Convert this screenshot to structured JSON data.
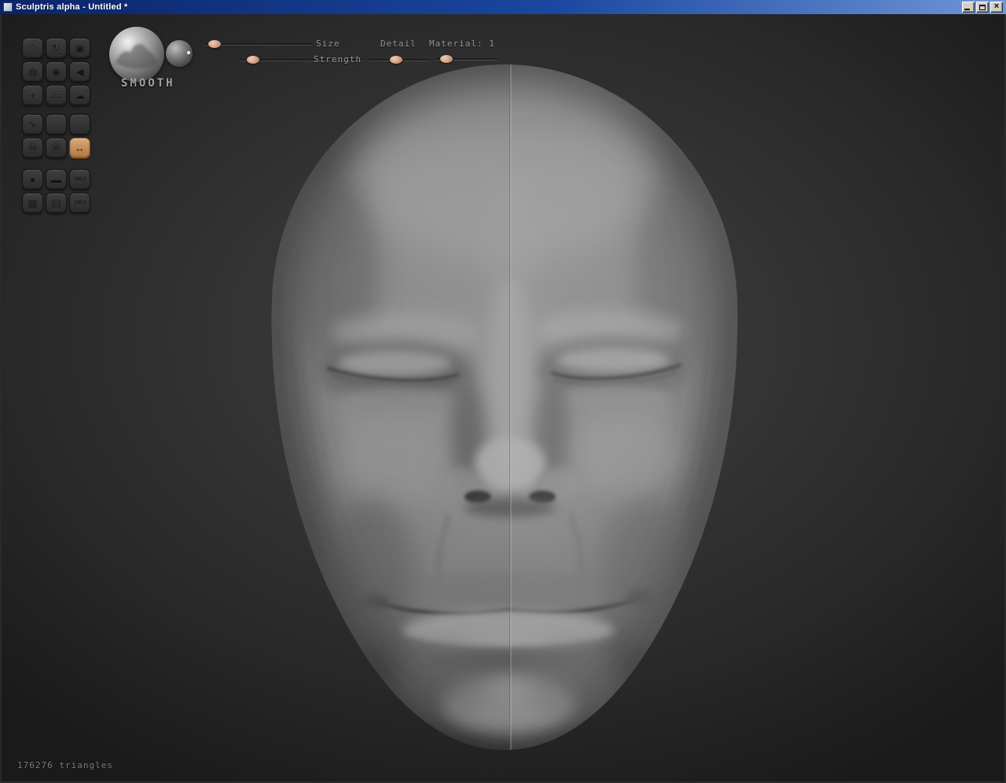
{
  "window": {
    "title": "Sculptris alpha - Untitled *",
    "close_glyph": "×"
  },
  "toolbar": {
    "brush_name": "SMOOTH",
    "sliders": {
      "size": {
        "label": "Size",
        "pct": 4
      },
      "strength": {
        "label": "Strength",
        "pct": 6
      },
      "detail": {
        "label": "Detail",
        "pct": 34
      },
      "material": {
        "label": "Material: 1",
        "pct": 9
      }
    }
  },
  "tools": {
    "sculpt": [
      {
        "id": "crease",
        "glyph": "◠"
      },
      {
        "id": "rotate",
        "glyph": "↻"
      },
      {
        "id": "scale",
        "glyph": "▣"
      },
      {
        "id": "draw",
        "glyph": "◍"
      },
      {
        "id": "inflate",
        "glyph": "◉"
      },
      {
        "id": "pinch",
        "glyph": "◀"
      },
      {
        "id": "grab",
        "glyph": "+"
      },
      {
        "id": "flatten",
        "glyph": "▭"
      },
      {
        "id": "smooth",
        "glyph": "☁"
      }
    ],
    "options": [
      {
        "id": "reduce",
        "glyph": "∿"
      },
      {
        "id": "toggle-a",
        "glyph": ""
      },
      {
        "id": "toggle-b",
        "glyph": ""
      },
      {
        "id": "material",
        "glyph": "Ⓜ"
      },
      {
        "id": "wireframe",
        "glyph": "Ⓦ"
      },
      {
        "id": "symmetry",
        "glyph": "↔",
        "active": true
      }
    ],
    "file": [
      {
        "id": "new-sphere",
        "glyph": "●"
      },
      {
        "id": "new-plane",
        "glyph": "▬"
      },
      {
        "id": "import-obj",
        "glyph": "OBJ"
      },
      {
        "id": "save",
        "glyph": "▦"
      },
      {
        "id": "load",
        "glyph": "▤"
      },
      {
        "id": "export-obj",
        "glyph": "OBJ"
      }
    ]
  },
  "status": {
    "triangles": "176276 triangles"
  },
  "colors": {
    "active_tool": "#c98f53",
    "slider_handle": "#d8a78c",
    "titlebar_left": "#0a246a",
    "titlebar_right": "#6e96d8",
    "viewport_center": "#3e3e3e",
    "viewport_edge": "#1a1a1a"
  }
}
